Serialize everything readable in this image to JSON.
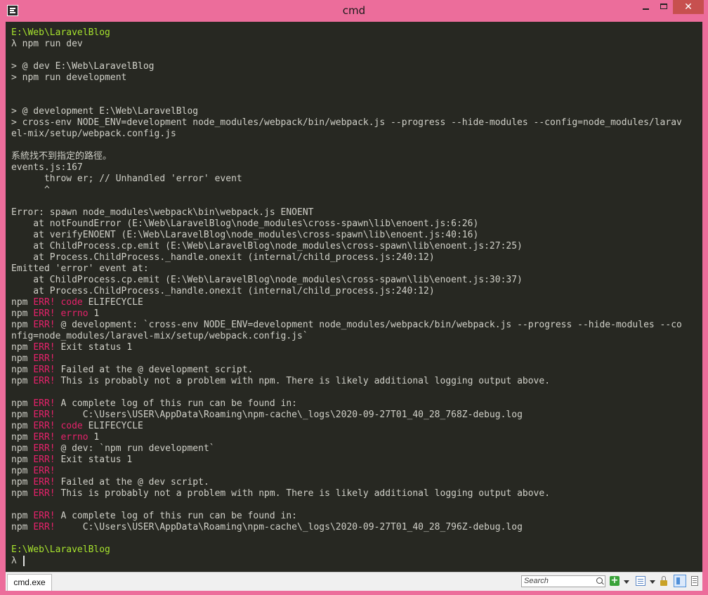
{
  "window": {
    "title": "cmd",
    "close_label": "✕"
  },
  "terminal": {
    "lines": [
      [
        {
          "t": "E:\\Web\\LaravelBlog",
          "c": "green"
        }
      ],
      [
        {
          "t": "λ npm run dev"
        }
      ],
      [
        {
          "t": ""
        }
      ],
      [
        {
          "t": "> @ dev E:\\Web\\LaravelBlog"
        }
      ],
      [
        {
          "t": "> npm run development"
        }
      ],
      [
        {
          "t": ""
        }
      ],
      [
        {
          "t": ""
        }
      ],
      [
        {
          "t": "> @ development E:\\Web\\LaravelBlog"
        }
      ],
      [
        {
          "t": "> cross-env NODE_ENV=development node_modules/webpack/bin/webpack.js --progress --hide-modules --config=node_modules/larav"
        }
      ],
      [
        {
          "t": "el-mix/setup/webpack.config.js"
        }
      ],
      [
        {
          "t": ""
        }
      ],
      [
        {
          "t": "系統找不到指定的路徑。"
        }
      ],
      [
        {
          "t": "events.js:167"
        }
      ],
      [
        {
          "t": "      throw er; // Unhandled 'error' event"
        }
      ],
      [
        {
          "t": "      ^"
        }
      ],
      [
        {
          "t": ""
        }
      ],
      [
        {
          "t": "Error: spawn node_modules\\webpack\\bin\\webpack.js ENOENT"
        }
      ],
      [
        {
          "t": "    at notFoundError (E:\\Web\\LaravelBlog\\node_modules\\cross-spawn\\lib\\enoent.js:6:26)"
        }
      ],
      [
        {
          "t": "    at verifyENOENT (E:\\Web\\LaravelBlog\\node_modules\\cross-spawn\\lib\\enoent.js:40:16)"
        }
      ],
      [
        {
          "t": "    at ChildProcess.cp.emit (E:\\Web\\LaravelBlog\\node_modules\\cross-spawn\\lib\\enoent.js:27:25)"
        }
      ],
      [
        {
          "t": "    at Process.ChildProcess._handle.onexit (internal/child_process.js:240:12)"
        }
      ],
      [
        {
          "t": "Emitted 'error' event at:"
        }
      ],
      [
        {
          "t": "    at ChildProcess.cp.emit (E:\\Web\\LaravelBlog\\node_modules\\cross-spawn\\lib\\enoent.js:30:37)"
        }
      ],
      [
        {
          "t": "    at Process.ChildProcess._handle.onexit (internal/child_process.js:240:12)"
        }
      ],
      [
        {
          "t": "npm "
        },
        {
          "t": "ERR!",
          "c": "red"
        },
        {
          "t": " "
        },
        {
          "t": "code",
          "c": "red"
        },
        {
          "t": " ELIFECYCLE"
        }
      ],
      [
        {
          "t": "npm "
        },
        {
          "t": "ERR!",
          "c": "red"
        },
        {
          "t": " "
        },
        {
          "t": "errno",
          "c": "red"
        },
        {
          "t": " 1"
        }
      ],
      [
        {
          "t": "npm "
        },
        {
          "t": "ERR!",
          "c": "red"
        },
        {
          "t": " @ development: `cross-env NODE_ENV=development node_modules/webpack/bin/webpack.js --progress --hide-modules --co"
        }
      ],
      [
        {
          "t": "nfig=node_modules/laravel-mix/setup/webpack.config.js`"
        }
      ],
      [
        {
          "t": "npm "
        },
        {
          "t": "ERR!",
          "c": "red"
        },
        {
          "t": " Exit status 1"
        }
      ],
      [
        {
          "t": "npm "
        },
        {
          "t": "ERR!",
          "c": "red"
        }
      ],
      [
        {
          "t": "npm "
        },
        {
          "t": "ERR!",
          "c": "red"
        },
        {
          "t": " Failed at the @ development script."
        }
      ],
      [
        {
          "t": "npm "
        },
        {
          "t": "ERR!",
          "c": "red"
        },
        {
          "t": " This is probably not a problem with npm. There is likely additional logging output above."
        }
      ],
      [
        {
          "t": ""
        }
      ],
      [
        {
          "t": "npm "
        },
        {
          "t": "ERR!",
          "c": "red"
        },
        {
          "t": " A complete log of this run can be found in:"
        }
      ],
      [
        {
          "t": "npm "
        },
        {
          "t": "ERR!",
          "c": "red"
        },
        {
          "t": "     C:\\Users\\USER\\AppData\\Roaming\\npm-cache\\_logs\\2020-09-27T01_40_28_768Z-debug.log"
        }
      ],
      [
        {
          "t": "npm "
        },
        {
          "t": "ERR!",
          "c": "red"
        },
        {
          "t": " "
        },
        {
          "t": "code",
          "c": "red"
        },
        {
          "t": " ELIFECYCLE"
        }
      ],
      [
        {
          "t": "npm "
        },
        {
          "t": "ERR!",
          "c": "red"
        },
        {
          "t": " "
        },
        {
          "t": "errno",
          "c": "red"
        },
        {
          "t": " 1"
        }
      ],
      [
        {
          "t": "npm "
        },
        {
          "t": "ERR!",
          "c": "red"
        },
        {
          "t": " @ dev: `npm run development`"
        }
      ],
      [
        {
          "t": "npm "
        },
        {
          "t": "ERR!",
          "c": "red"
        },
        {
          "t": " Exit status 1"
        }
      ],
      [
        {
          "t": "npm "
        },
        {
          "t": "ERR!",
          "c": "red"
        }
      ],
      [
        {
          "t": "npm "
        },
        {
          "t": "ERR!",
          "c": "red"
        },
        {
          "t": " Failed at the @ dev script."
        }
      ],
      [
        {
          "t": "npm "
        },
        {
          "t": "ERR!",
          "c": "red"
        },
        {
          "t": " This is probably not a problem with npm. There is likely additional logging output above."
        }
      ],
      [
        {
          "t": ""
        }
      ],
      [
        {
          "t": "npm "
        },
        {
          "t": "ERR!",
          "c": "red"
        },
        {
          "t": " A complete log of this run can be found in:"
        }
      ],
      [
        {
          "t": "npm "
        },
        {
          "t": "ERR!",
          "c": "red"
        },
        {
          "t": "     C:\\Users\\USER\\AppData\\Roaming\\npm-cache\\_logs\\2020-09-27T01_40_28_796Z-debug.log"
        }
      ],
      [
        {
          "t": ""
        }
      ],
      [
        {
          "t": "E:\\Web\\LaravelBlog",
          "c": "green"
        }
      ],
      [
        {
          "t": "λ "
        }
      ]
    ]
  },
  "statusbar": {
    "tab_label": "cmd.exe",
    "search_placeholder": "Search",
    "add_label": "+"
  },
  "colors": {
    "frame": "#ec6d9b",
    "terminal_bg": "#272822",
    "text": "#d0d0c8",
    "prompt_green": "#a6e22e",
    "err_red": "#e6226b"
  }
}
